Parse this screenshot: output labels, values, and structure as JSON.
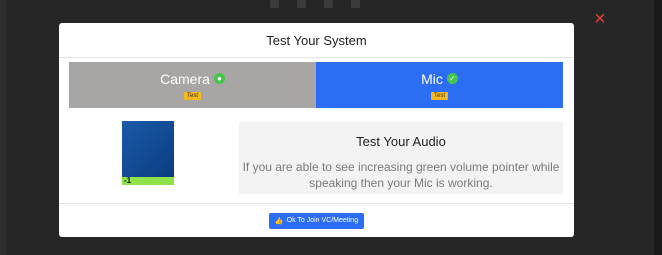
{
  "background": {
    "toolbar_icons": [
      "phone-icon",
      "hand-icon",
      "chat-icon",
      "settings-icon"
    ]
  },
  "close_icon": "×",
  "modal": {
    "title": "Test Your System",
    "tabs": [
      {
        "label": "Camera",
        "badge": "Test",
        "check": "●"
      },
      {
        "label": "Mic",
        "badge": "Test",
        "check": "✓"
      }
    ],
    "preview": {
      "level_number": "-1"
    },
    "info": {
      "title": "Test Your Audio",
      "text": "If you are able to see increasing green volume pointer while speaking then your Mic is working."
    },
    "footer": {
      "button_icon": "👍",
      "button_label": "Ok To Join VC/Meeting"
    }
  },
  "colors": {
    "primary": "#2b6ef5",
    "camera_tab": "#a8a6a4",
    "badge": "#f5b81c",
    "success": "#45c64a",
    "close": "#e0403a"
  }
}
